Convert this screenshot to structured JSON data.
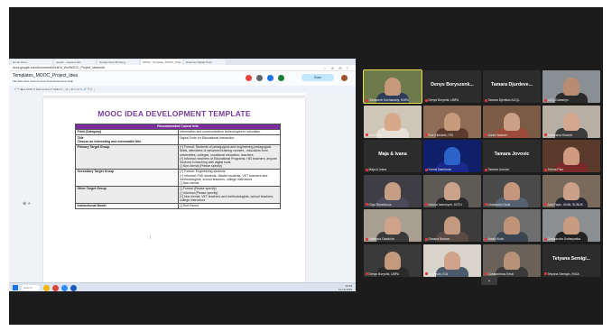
{
  "browser": {
    "tabs": [
      "Home Grec...",
      "ueastu - request slot...",
      "Google Docs Booking ...",
      "MOOC_Template_MOOC_Proje...",
      "Erasmus Digital Tools"
    ],
    "address": "docs.google.com/document/d/1sKb_Wv/MOOC_Project_Idea/edit",
    "address_icons": "☆ ⊕ ⊞ ≡"
  },
  "doc": {
    "title": "Templates_MOOC_Project_Idea",
    "menu": "File  Edit  View  Insert  Format  Tools  Extensions  Help",
    "share_label": "Share",
    "toolbar": "↶ ↷ 🖶 A  100% ▾  Normal text ▾  Calibri ▾  –  11  +  B  I  U  A  ✎  🔗  ☰  ≡  ⋮",
    "heading": "MOOC IDEA DEVELOPMENT TEMPLATE",
    "table_header": "Recommended Course Info",
    "rows": [
      {
        "label": "Field (Category)",
        "value": "Information and communication technologies in education"
      },
      {
        "label": "Title\nChoose an interesting and memorable title",
        "value": "Digital Tools for Educational Interaction"
      },
      {
        "label": "Primary Target Group",
        "value": "[+] Formal: Students of pedagogical and engineering pedagogical fields, attendees of advanced training courses - educators from universities, colleges, vocational education, teachers\n[+] Informal: teachers of Educational Programs, HEI teachers, anyone involved in teaching with digital tools.\n[ ] Non-formal (Please specify)"
      },
      {
        "label": "Secondary Target Group",
        "value": "[+] Formal: Engineering students\n[+] Informal: PhD students, Master students, VET teachers and methodologists, school teachers, college instructors\n[ ] Non-formal"
      },
      {
        "label": "Other Target Group",
        "value": "[ ] Formal (Please specify)\n[ ] Informal (Please specify)\n[+] Non-formal: VET teachers and methodologists, school teachers, college instructors"
      },
      {
        "label": "Instructional Model",
        "value": "[ ] Self-Paced"
      }
    ],
    "comment_control": "⊕ +",
    "cursor": "I"
  },
  "taskbar": {
    "search": "Search",
    "tray_time": "10:48",
    "tray_date": "12.10.2023"
  },
  "participants": [
    {
      "name": "Oleksandr Kuchanskiy, KNEU",
      "big": "",
      "active": true,
      "video": true,
      "skin": "#c49a7a",
      "shirt": "#2e3e58",
      "bg": "#6f7a4c"
    },
    {
      "name": "Denys Boryshk, UBPA",
      "big": "Denys Boryszenk...",
      "active": false,
      "video": false
    },
    {
      "name": "Tamara Djenikos ACQL",
      "big": "Tamara Djurdeve...",
      "active": false,
      "video": false
    },
    {
      "name": "ACQ Zubashyn",
      "big": "",
      "active": false,
      "video": true,
      "skin": "#b78c70",
      "shirt": "#2a2a2a",
      "bg": "#8a8f94"
    },
    {
      "name": "Inkka Kill",
      "big": "",
      "active": false,
      "video": true,
      "skin": "#d8a88a",
      "shirt": "#e7e0d6",
      "bg": "#cfc6b8"
    },
    {
      "name": "Eva Cibruletz, ITB",
      "big": "",
      "active": false,
      "video": true,
      "skin": "#c69a7c",
      "shirt": "#5a3b2e",
      "bg": "#8e6c56"
    },
    {
      "name": "Anna Hackner",
      "big": "",
      "active": false,
      "video": true,
      "skin": "#caa086",
      "shirt": "#9c4a3c",
      "bg": "#7c5b46"
    },
    {
      "name": "Ivancheva Kharkiv",
      "big": "",
      "active": false,
      "video": true,
      "skin": "#d4a88e",
      "shirt": "#3b3b3b",
      "bg": "#b7aea4"
    },
    {
      "name": "Maja & Ivana",
      "big": "Maja & Ivana",
      "active": false,
      "video": false
    },
    {
      "name": "Kemal Damirovic",
      "big": "",
      "active": false,
      "video": true,
      "skin": "#2b63c9",
      "shirt": "#1a2a8a",
      "bg": "#0f1f6a"
    },
    {
      "name": "Tamara Jovovic",
      "big": "Tamara Jovovic",
      "active": false,
      "video": false
    },
    {
      "name": "Jelena Plaz",
      "big": "",
      "active": false,
      "video": true,
      "skin": "#d09a80",
      "shirt": "#7a2a2a",
      "bg": "#5a3a2a"
    },
    {
      "name": "Olga Ravenkova",
      "big": "",
      "active": false,
      "video": true,
      "skin": "#c69e84",
      "shirt": "#4a4a5a",
      "bg": "#3e3e44"
    },
    {
      "name": "Ivanna Ivanovych, DSTU",
      "big": "",
      "active": false,
      "video": true,
      "skin": "#caa38a",
      "shirt": "#2a2a2a",
      "bg": "#5e5a56"
    },
    {
      "name": "Lihasevich Danil",
      "big": "",
      "active": false,
      "video": true,
      "skin": "#c4977c",
      "shirt": "#556070",
      "bg": "#4a4a4a"
    },
    {
      "name": "Ana Papic, UNIN, SUNUK",
      "big": "",
      "active": false,
      "video": true,
      "skin": "#caa088",
      "shirt": "#2a2a34",
      "bg": "#7a6a5c"
    },
    {
      "name": "Kateryna Osadcha",
      "big": "",
      "active": false,
      "video": true,
      "skin": "#cfa38a",
      "shirt": "#3a3a3a",
      "bg": "#a99e92"
    },
    {
      "name": "Oksana Bodnar",
      "big": "",
      "active": false,
      "video": true,
      "skin": "#c39a80",
      "shirt": "#5a4a46",
      "bg": "#3c3c3c"
    },
    {
      "name": "Andrii Kizim",
      "big": "",
      "active": false,
      "video": true,
      "skin": "#bf9478",
      "shirt": "#3c4652",
      "bg": "#6e6e6e"
    },
    {
      "name": "Oleksandra Sotlasynska",
      "big": "",
      "active": false,
      "video": true,
      "skin": "#c79c80",
      "shirt": "#222222",
      "bg": "#8c8f92"
    },
    {
      "name": "Denys Boryshk, UBPA",
      "big": "",
      "active": false,
      "video": true,
      "skin": "#c49a7e",
      "shirt": "#2a2a2a",
      "bg": "#3a3a3a"
    },
    {
      "name": "LouPhuis, ICA",
      "big": "",
      "active": false,
      "video": true,
      "skin": "#cfa48a",
      "shirt": "#4a5a6a",
      "bg": "#d8d4cc"
    },
    {
      "name": "Constantinos Kesti",
      "big": "",
      "active": false,
      "video": true,
      "skin": "#b89276",
      "shirt": "#3a3a3a",
      "bg": "#6a6258"
    },
    {
      "name": "Tetyana Semigin, INGA",
      "big": "Tetyana Semigi...",
      "active": false,
      "video": false
    }
  ],
  "expand_icon": "chevron-down-icon",
  "colors": {
    "heading_purple": "#7c3a9c",
    "table_header_purple": "#7d2e9e",
    "active_speaker": "#e7e24a",
    "muted_mic": "#e0333c"
  }
}
